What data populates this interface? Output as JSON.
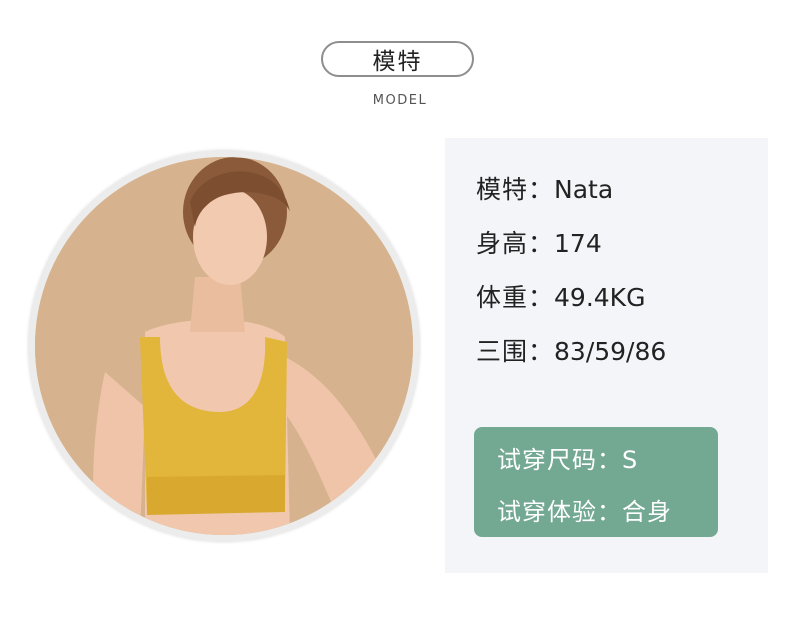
{
  "header": {
    "title": "模特",
    "subtitle": "MODEL"
  },
  "model_info": [
    {
      "label": "模特：",
      "value": "Nata"
    },
    {
      "label": "身高：",
      "value": "174"
    },
    {
      "label": "体重：",
      "value": "49.4KG"
    },
    {
      "label": "三围：",
      "value": "83/59/86"
    }
  ],
  "fit_info": [
    {
      "label": "试穿尺码：",
      "value": "S"
    },
    {
      "label": "试穿体验：",
      "value": "合身"
    }
  ],
  "colors": {
    "panel_bg": "#f3f5f9",
    "fit_box_bg": "#73a893",
    "photo_bg": "#d5b28c",
    "garment": "#e2b63a"
  }
}
